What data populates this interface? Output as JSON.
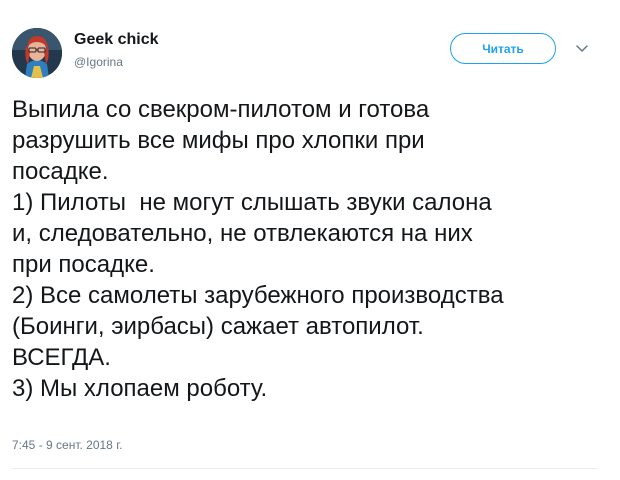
{
  "author": {
    "display_name": "Geek chick",
    "handle": "@Igorina",
    "avatar_icon": "avatar-image"
  },
  "actions": {
    "follow_label": "Читать",
    "menu_icon": "chevron-down-icon"
  },
  "tweet": {
    "lines": [
      "Выпила со свекром-пилотом и готова",
      "разрушить все мифы про хлопки при",
      "посадке.",
      "1) Пилоты  не могут слышать звуки салона",
      "и, следовательно, не отвлекаются на них",
      "при посадке.",
      "2) Все самолеты зарубежного производства",
      "(Боинги, эирбасы) сажает автопилот.",
      "ВСЕГДА.",
      "3) Мы хлопаем роботу."
    ],
    "timestamp": "7:45 - 9 сент. 2018 г."
  },
  "colors": {
    "accent": "#1da1f2",
    "text": "#14171a",
    "muted": "#657786",
    "divider": "#e6ecf0"
  }
}
